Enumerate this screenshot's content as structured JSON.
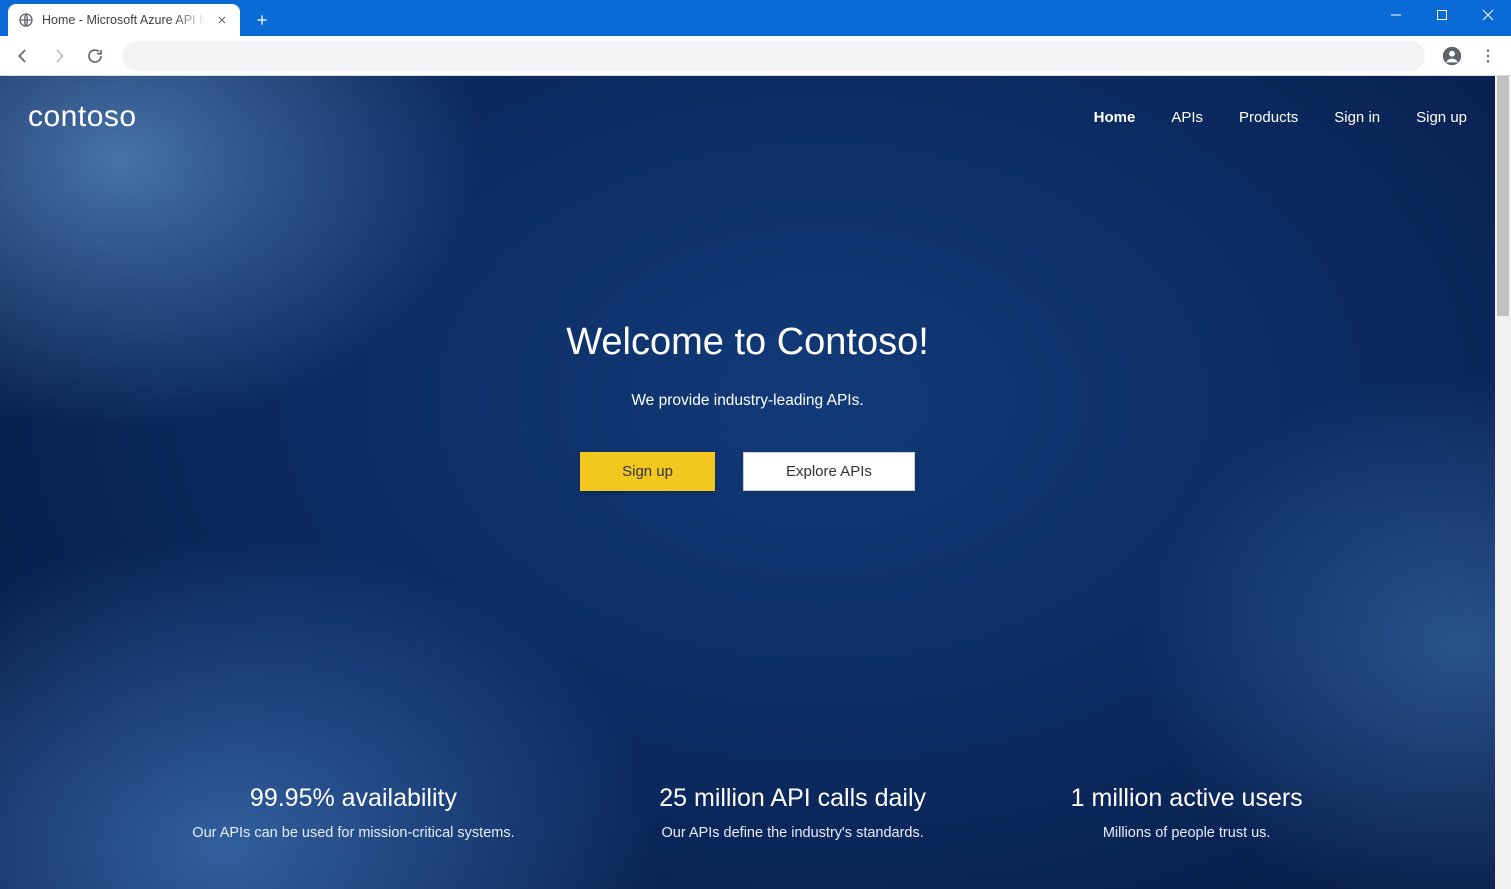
{
  "browser": {
    "tab_title": "Home - Microsoft Azure API Management"
  },
  "site": {
    "brand": "contoso",
    "nav": {
      "home": "Home",
      "apis": "APIs",
      "products": "Products",
      "signin": "Sign in",
      "signup": "Sign up"
    }
  },
  "hero": {
    "title": "Welcome to Contoso!",
    "subtitle": "We provide industry-leading APIs.",
    "signup_label": "Sign up",
    "explore_label": "Explore APIs"
  },
  "stats": {
    "items": [
      {
        "headline": "99.95% availability",
        "sub": "Our APIs can be used for mission-critical systems."
      },
      {
        "headline": "25 million API calls daily",
        "sub": "Our APIs define the industry's standards."
      },
      {
        "headline": "1 million active users",
        "sub": "Millions of people trust us."
      }
    ]
  }
}
